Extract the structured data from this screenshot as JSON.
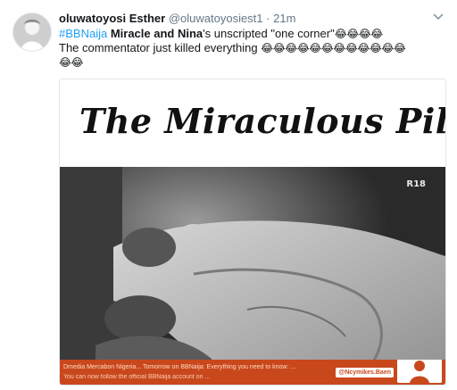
{
  "tweet": {
    "display_name": "oluwatoyosi Esther",
    "handle": "@oluwatoyosiest1",
    "separator": "·",
    "time": "21m",
    "text": {
      "hashtag": "#BBNaija",
      "bold_names": "Miracle and Nina",
      "part1": "'s unscripted \"one corner\"",
      "emojis1": "😂😂😂😂",
      "line2": "The commentator just killed everything",
      "emojis2": "😂😂😂😂😂😂😂😂😂😂😂😂",
      "emojis3": "😂😂"
    }
  },
  "media": {
    "title": "The Miraculous Pilot..",
    "watermark": "R18",
    "ticker_line1": "Dmedia Mercabon Nigeria... Tomorrow on BBNaija: Everything you need to know: ...",
    "ticker_line2": "You can now follow the official BBNaija account on ...",
    "ticker_handle": "@Ncymikes.Baen"
  },
  "icons": {
    "avatar": "profile-avatar",
    "menu": "chevron-down-icon"
  },
  "colors": {
    "link": "#1da1f2",
    "muted": "#657786",
    "ticker": "#c8481c"
  }
}
